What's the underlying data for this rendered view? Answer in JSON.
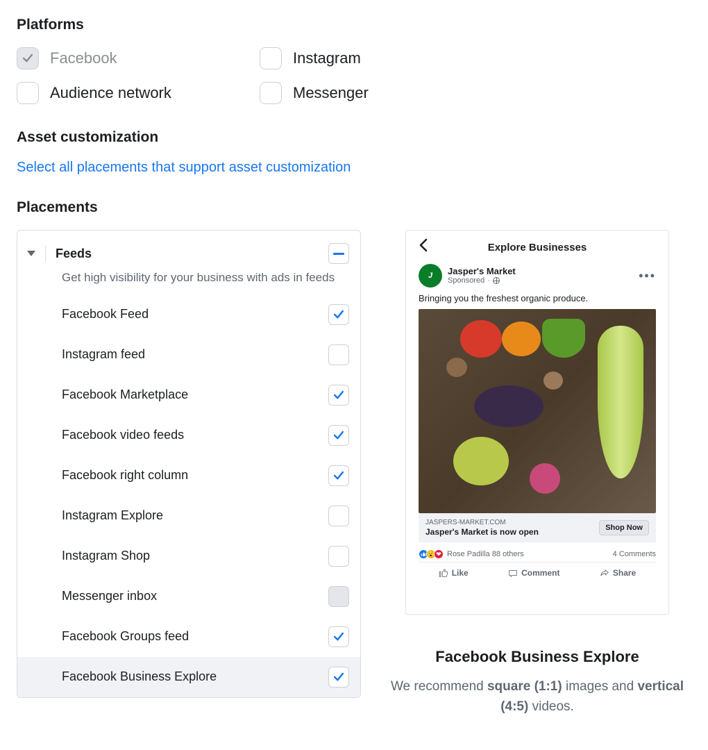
{
  "platforms_heading": "Platforms",
  "platforms": [
    {
      "label": "Facebook",
      "locked": true,
      "checked": true
    },
    {
      "label": "Instagram",
      "locked": false,
      "checked": false
    },
    {
      "label": "Audience network",
      "locked": false,
      "checked": false
    },
    {
      "label": "Messenger",
      "locked": false,
      "checked": false
    }
  ],
  "asset_heading": "Asset customization",
  "asset_link": "Select all placements that support asset customization",
  "placements_heading": "Placements",
  "group": {
    "title": "Feeds",
    "desc": "Get high visibility for your business with ads in feeds",
    "state": "indeterminate"
  },
  "placements": [
    {
      "label": "Facebook Feed",
      "checked": true,
      "selected": false
    },
    {
      "label": "Instagram feed",
      "checked": false,
      "selected": false
    },
    {
      "label": "Facebook Marketplace",
      "checked": true,
      "selected": false
    },
    {
      "label": "Facebook video feeds",
      "checked": true,
      "selected": false
    },
    {
      "label": "Facebook right column",
      "checked": true,
      "selected": false
    },
    {
      "label": "Instagram Explore",
      "checked": false,
      "selected": false
    },
    {
      "label": "Instagram Shop",
      "checked": false,
      "selected": false
    },
    {
      "label": "Messenger inbox",
      "checked": false,
      "selected": false,
      "disabled": true
    },
    {
      "label": "Facebook Groups feed",
      "checked": true,
      "selected": false
    },
    {
      "label": "Facebook Business Explore",
      "checked": true,
      "selected": true
    }
  ],
  "preview": {
    "phone_title": "Explore Businesses",
    "page_name": "Jasper's Market",
    "sponsored": "Sponsored",
    "post_text": "Bringing you the freshest organic produce.",
    "domain": "JASPERS-MARKET.COM",
    "headline": "Jasper's Market is now open",
    "shop_btn": "Shop Now",
    "reactions_text": "Rose Padilla 88 others",
    "comments_text": "4 Comments",
    "like": "Like",
    "comment": "Comment",
    "share": "Share",
    "caption_title": "Facebook Business Explore",
    "caption_text_pre": "We recommend ",
    "caption_bold1": "square (1:1)",
    "caption_mid": " images and ",
    "caption_bold2": "vertical (4:5)",
    "caption_post": " videos."
  }
}
